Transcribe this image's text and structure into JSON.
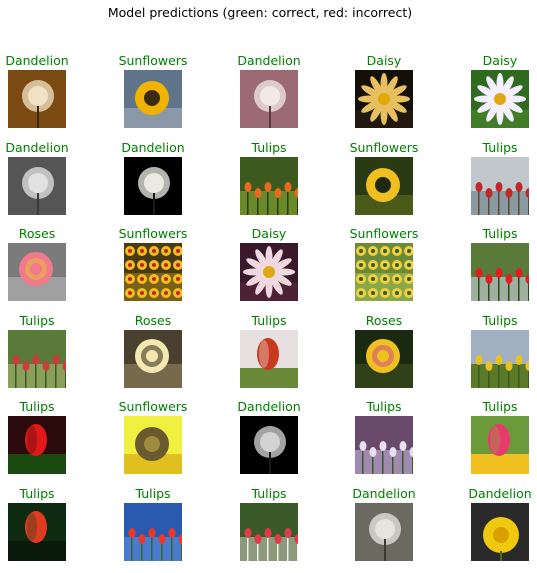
{
  "figure": {
    "title": "Model predictions (green: correct, red: incorrect)"
  },
  "colors": {
    "correct": "#008000",
    "incorrect": "#ff0000"
  },
  "predictions": [
    {
      "label": "Dandelion",
      "correct": true,
      "image": "dandelion-seed-head-photo",
      "palette": [
        "#7a4a12",
        "#b07a2a",
        "#f4e6c8",
        "#3d2508"
      ]
    },
    {
      "label": "Sunflowers",
      "correct": true,
      "image": "sunflower-photo",
      "palette": [
        "#5f7488",
        "#8a98a8",
        "#f2b300",
        "#3a2a10"
      ]
    },
    {
      "label": "Dandelion",
      "correct": true,
      "image": "dandelion-seed-head-photo",
      "palette": [
        "#9c6a72",
        "#c89aa0",
        "#f2ece8",
        "#5a3a3a"
      ]
    },
    {
      "label": "Daisy",
      "correct": true,
      "image": "daisy-photo",
      "palette": [
        "#141008",
        "#2a2010",
        "#e8c060",
        "#1e1808"
      ]
    },
    {
      "label": "Daisy",
      "correct": true,
      "image": "daisy-photo",
      "palette": [
        "#2f6a1e",
        "#4e8a2c",
        "#f4f0ff",
        "#c89a20"
      ]
    },
    {
      "label": "Dandelion",
      "correct": true,
      "image": "dandelion-seed-head-photo",
      "palette": [
        "#555555",
        "#8c8c8c",
        "#e6e6e6",
        "#3a3a3a"
      ]
    },
    {
      "label": "Dandelion",
      "correct": true,
      "image": "dandelion-seed-head-photo",
      "palette": [
        "#000000",
        "#0a0a0a",
        "#f0f0e8",
        "#1a1a1a"
      ]
    },
    {
      "label": "Tulips",
      "correct": true,
      "image": "tulip-field-photo",
      "palette": [
        "#3c5a1e",
        "#6a8a2a",
        "#e86a20",
        "#2a3a14"
      ]
    },
    {
      "label": "Sunflowers",
      "correct": true,
      "image": "sunflower-photo",
      "palette": [
        "#2a3a12",
        "#4a5a18",
        "#f0c020",
        "#1e2a0c"
      ]
    },
    {
      "label": "Tulips",
      "correct": true,
      "image": "tulip-field-photo",
      "palette": [
        "#c0c8cc",
        "#8a9aa0",
        "#c0282a",
        "#5a4a3a"
      ]
    },
    {
      "label": "Roses",
      "correct": true,
      "image": "rose-photo",
      "palette": [
        "#7a7a7a",
        "#b0b0b0",
        "#f07a8a",
        "#e8c040"
      ]
    },
    {
      "label": "Sunflowers",
      "correct": true,
      "image": "sunflower-field-photo",
      "palette": [
        "#4a3a10",
        "#7a6018",
        "#f0c020",
        "#c82020"
      ]
    },
    {
      "label": "Daisy",
      "correct": true,
      "image": "daisy-photo",
      "palette": [
        "#3a1a2a",
        "#5a2a3a",
        "#f0d8e0",
        "#2a3a14"
      ]
    },
    {
      "label": "Sunflowers",
      "correct": true,
      "image": "sunflower-field-photo",
      "palette": [
        "#6a8a3a",
        "#8aa848",
        "#f0d040",
        "#3a5a1e"
      ]
    },
    {
      "label": "Tulips",
      "correct": true,
      "image": "tulip-field-photo",
      "palette": [
        "#5a7a3a",
        "#a0b0a0",
        "#e02020",
        "#2a4a1a"
      ]
    },
    {
      "label": "Tulips",
      "correct": true,
      "image": "tulip-garden-photo",
      "palette": [
        "#5a7a3a",
        "#8aa05a",
        "#d03a3a",
        "#3a5a2a"
      ]
    },
    {
      "label": "Roses",
      "correct": true,
      "image": "rose-photo",
      "palette": [
        "#4a4030",
        "#8a7a58",
        "#f4e8b0",
        "#2a2418"
      ]
    },
    {
      "label": "Tulips",
      "correct": true,
      "image": "tulip-photo",
      "palette": [
        "#e8e0e0",
        "#f4f0f0",
        "#c83a1e",
        "#6a8a3a"
      ]
    },
    {
      "label": "Roses",
      "correct": true,
      "image": "rose-photo",
      "palette": [
        "#1a2a10",
        "#3a4a1e",
        "#f0c020",
        "#d04a8a"
      ]
    },
    {
      "label": "Tulips",
      "correct": true,
      "image": "tulip-field-photo",
      "palette": [
        "#a0b0c0",
        "#5a7a2a",
        "#e8c020",
        "#3a5a1e"
      ]
    },
    {
      "label": "Tulips",
      "correct": true,
      "image": "tulip-photo",
      "palette": [
        "#2a0a0a",
        "#4a0e0e",
        "#e01818",
        "#1a4a10"
      ]
    },
    {
      "label": "Sunflowers",
      "correct": true,
      "image": "sunflower-photo",
      "palette": [
        "#f0f040",
        "#e0c020",
        "#6a5a30",
        "#a08a40"
      ]
    },
    {
      "label": "Dandelion",
      "correct": true,
      "image": "dandelion-seed-head-photo",
      "palette": [
        "#000000",
        "#0a0a0a",
        "#d8d8d8",
        "#1a1a1a"
      ]
    },
    {
      "label": "Tulips",
      "correct": true,
      "image": "tulip-field-photo",
      "palette": [
        "#6a4a6a",
        "#a08ab0",
        "#e8e0f0",
        "#3a5a2a"
      ]
    },
    {
      "label": "Tulips",
      "correct": true,
      "image": "tulip-photo",
      "palette": [
        "#6a9a3a",
        "#8ab04a",
        "#e83a6a",
        "#f0c020"
      ]
    },
    {
      "label": "Tulips",
      "correct": true,
      "image": "tulip-photo",
      "palette": [
        "#0e2a10",
        "#1e4a1e",
        "#e03a20",
        "#0a1a0a"
      ]
    },
    {
      "label": "Tulips",
      "correct": true,
      "image": "tulip-garden-photo",
      "palette": [
        "#2a5ab0",
        "#4a7ad0",
        "#e83a2a",
        "#3a6a1e"
      ]
    },
    {
      "label": "Tulips",
      "correct": true,
      "image": "tulip-field-photo",
      "palette": [
        "#3a5a2a",
        "#8a9a7a",
        "#e03a4a",
        "#f0f0f0"
      ]
    },
    {
      "label": "Dandelion",
      "correct": true,
      "image": "dandelion-seed-head-photo",
      "palette": [
        "#6a6a60",
        "#9a9a90",
        "#e8e8e0",
        "#3a3a30"
      ]
    },
    {
      "label": "Dandelion",
      "correct": true,
      "image": "dandelion-flower-photo",
      "palette": [
        "#2a2a2a",
        "#3a3a3a",
        "#f0c810",
        "#1a1a1a"
      ]
    }
  ]
}
